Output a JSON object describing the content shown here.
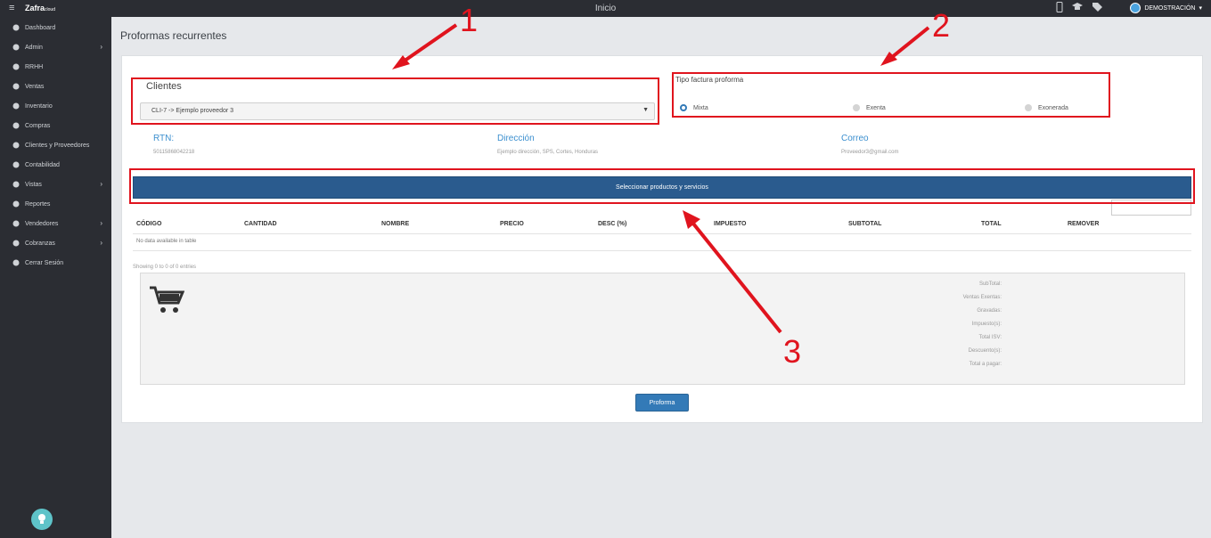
{
  "topbar": {
    "menu_icon": "hamburger-icon",
    "logo_text": "Zafra",
    "logo_small": "cloud",
    "title": "Inicio",
    "icons": [
      "phone-icon",
      "graduation-cap-icon",
      "tags-icon"
    ],
    "user_name": "DEMOSTRACIÓN"
  },
  "sidebar": {
    "items": [
      {
        "label": "Dashboard",
        "icon": "dashboard-icon",
        "chevron": false
      },
      {
        "label": "Admin",
        "icon": "wrench-icon",
        "chevron": true
      },
      {
        "label": "RRHH",
        "icon": "link-icon",
        "chevron": false
      },
      {
        "label": "Ventas",
        "icon": "money-icon",
        "chevron": false
      },
      {
        "label": "Inventario",
        "icon": "list-icon",
        "chevron": false
      },
      {
        "label": "Compras",
        "icon": "cart-icon",
        "chevron": false
      },
      {
        "label": "Clientes y Proveedores",
        "icon": "book-icon",
        "chevron": false
      },
      {
        "label": "Contabilidad",
        "icon": "link-icon",
        "chevron": false
      },
      {
        "label": "Vistas",
        "icon": "edit-icon",
        "chevron": true
      },
      {
        "label": "Reportes",
        "icon": "book-icon",
        "chevron": false
      },
      {
        "label": "Vendedores",
        "icon": "user-icon",
        "chevron": true
      },
      {
        "label": "Cobranzas",
        "icon": "edit-icon",
        "chevron": true
      },
      {
        "label": "Cerrar Sesión",
        "icon": "power-icon",
        "chevron": false
      }
    ]
  },
  "page": {
    "title": "Proformas recurrentes",
    "clientes_label": "Clientes",
    "clientes_selected": "CLI-7 -> Ejemplo proveedor 3",
    "tipo_label": "Tipo factura proforma",
    "radio_options": [
      "Mixta",
      "Exenta",
      "Exonerada"
    ],
    "radio_selected": "Mixta",
    "rtn_label": "RTN:",
    "rtn_value": "50115868042218",
    "direccion_label": "Dirección",
    "direccion_value": "Ejemplo dirección, SPS, Cortes, Honduras",
    "correo_label": "Correo",
    "correo_value": "Proveedor3@gmail.com",
    "select_button": "Seleccionar productos y servicios",
    "table_headers": [
      "CÓDIGO",
      "CANTIDAD",
      "NOMBRE",
      "PRECIO",
      "DESC (%)",
      "IMPUESTO",
      "SUBTOTAL",
      "TOTAL",
      "REMOVER"
    ],
    "no_data": "No data available in table",
    "showing": "Showing 0 to 0 of 0 entries",
    "summary": [
      "SubTotal:",
      "Ventas Exentas:",
      "Gravadas:",
      "Impuesto(s):",
      "Total ISV:",
      "Descuento(s):",
      "Total a pagar:"
    ],
    "proforma_button": "Proforma"
  },
  "annotations": [
    "1",
    "2",
    "3"
  ],
  "colors": {
    "annotation": "#e0141e",
    "primary": "#2a5b8e",
    "sidebar": "#2b2d33"
  }
}
